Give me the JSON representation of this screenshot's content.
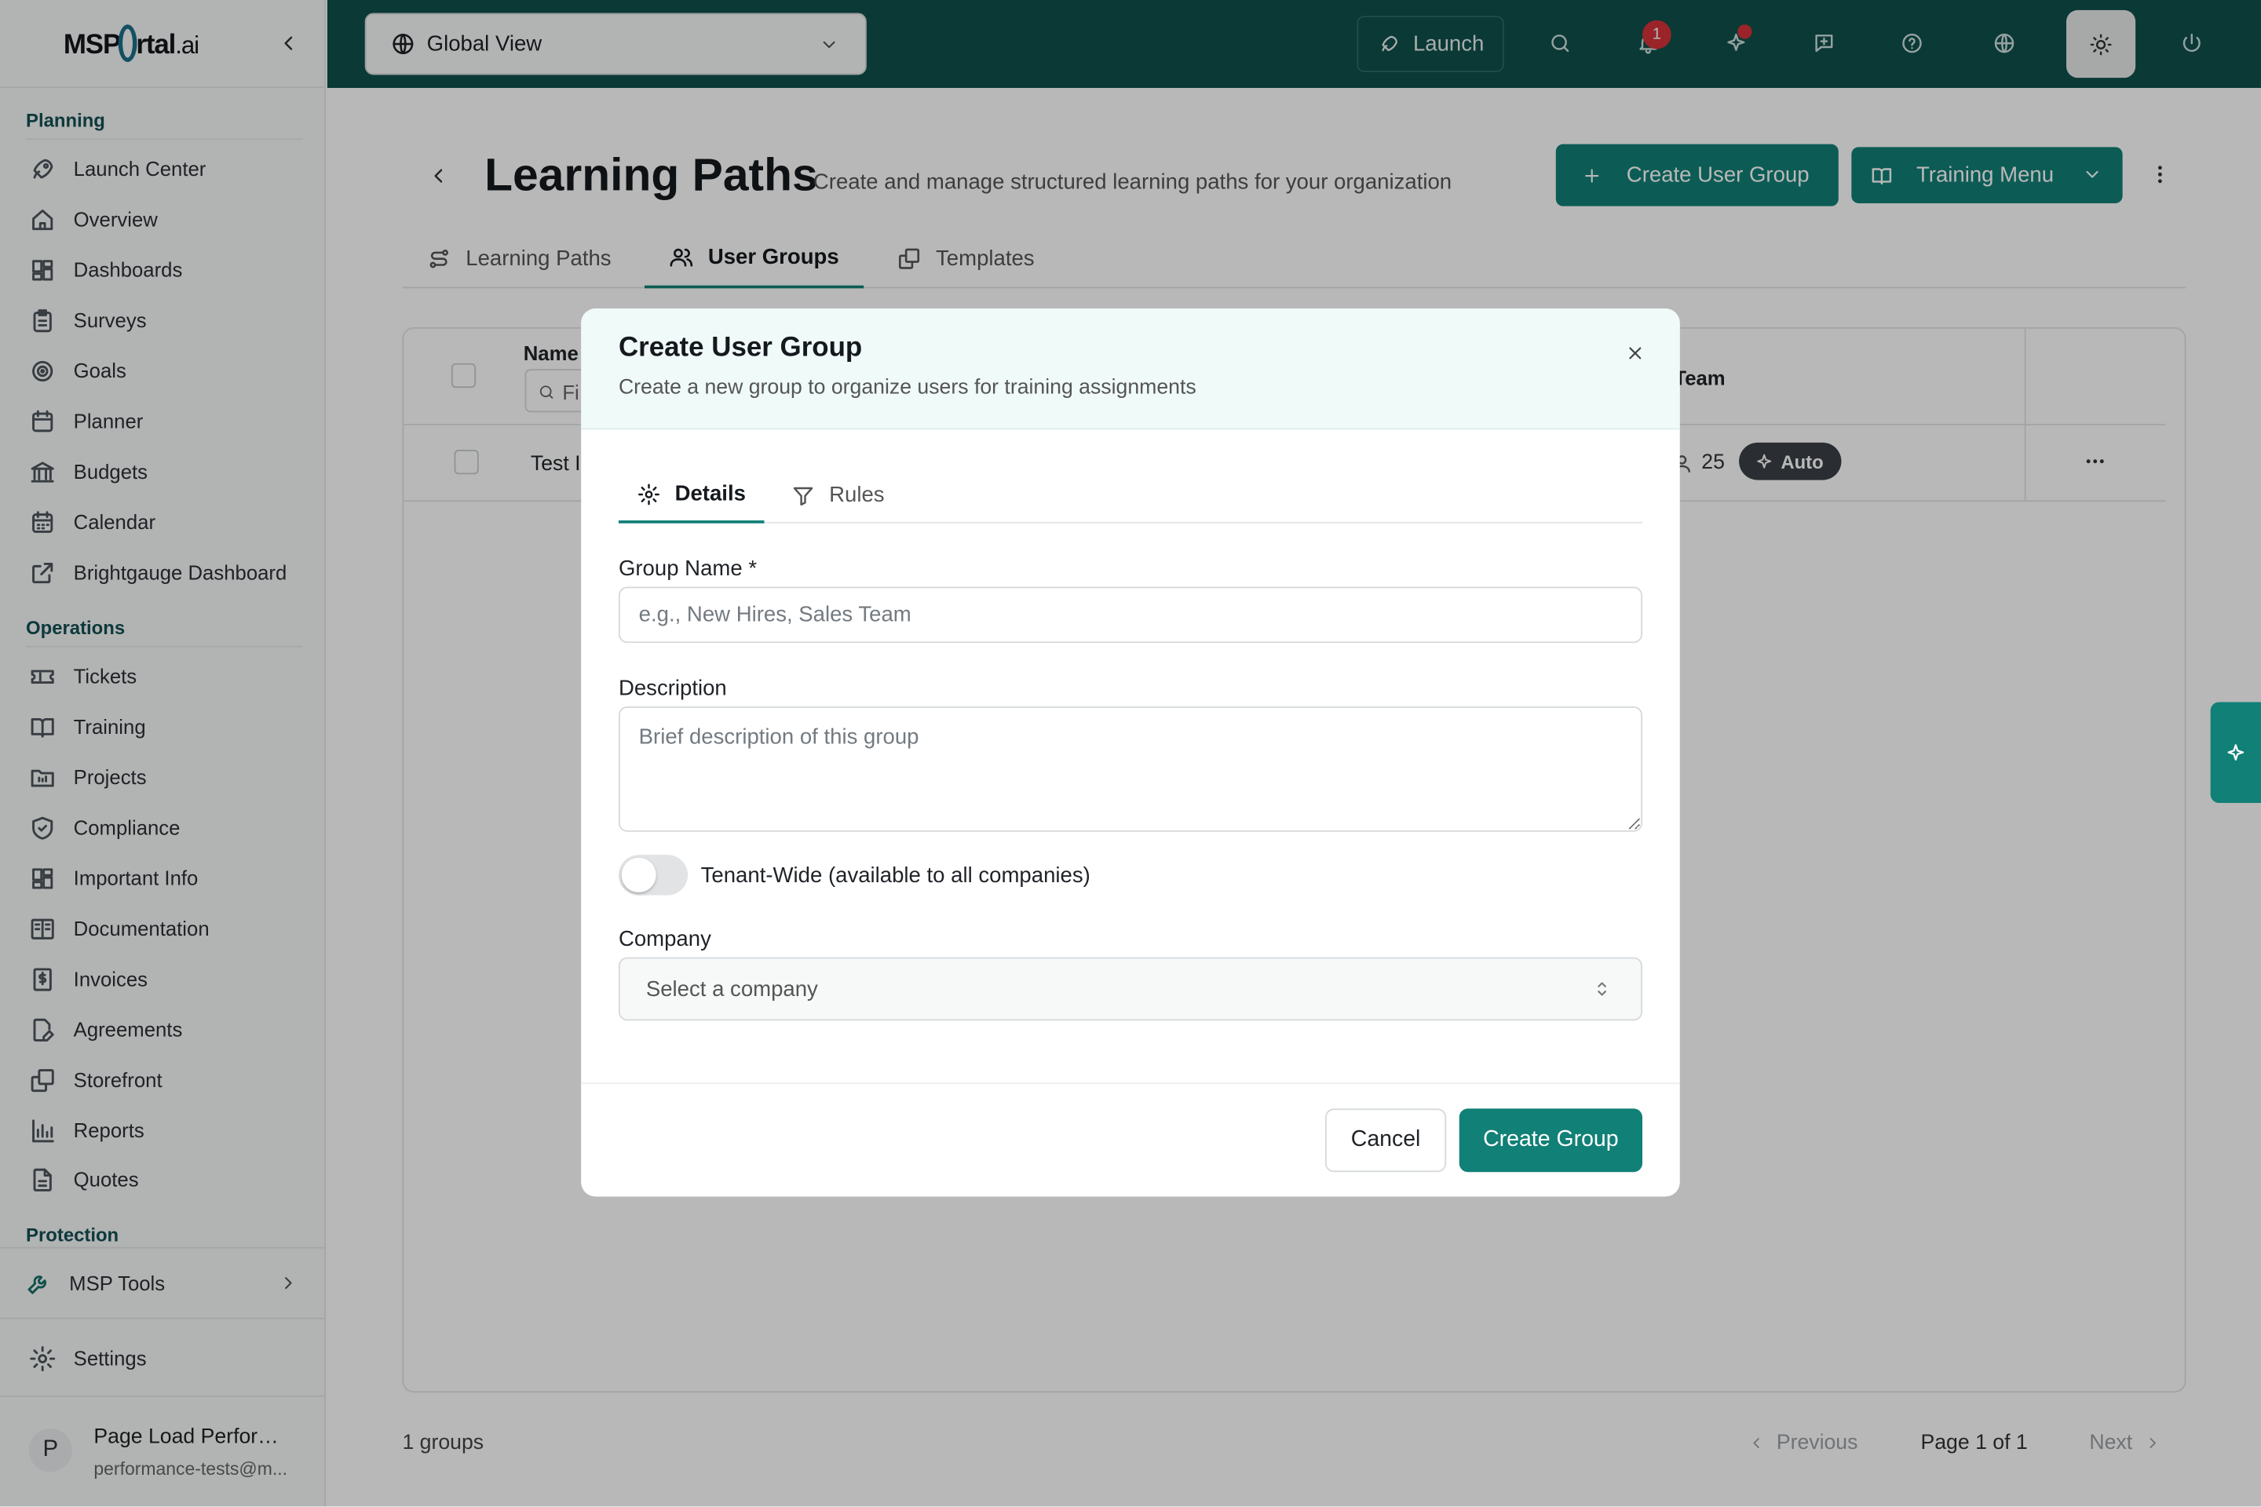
{
  "brand": {
    "logo_prefix": "MSP",
    "logo_mid": "rtal",
    "logo_suffix": ".ai"
  },
  "sidebar": {
    "sections": [
      {
        "title": "Planning",
        "items": [
          "Launch Center",
          "Overview",
          "Dashboards",
          "Surveys",
          "Goals",
          "Planner",
          "Budgets",
          "Calendar",
          "Brightgauge Dashboard"
        ]
      },
      {
        "title": "Operations",
        "items": [
          "Tickets",
          "Training",
          "Projects",
          "Compliance",
          "Important Info",
          "Documentation",
          "Invoices",
          "Agreements",
          "Storefront",
          "Reports",
          "Quotes"
        ]
      },
      {
        "title": "Protection",
        "items": []
      }
    ],
    "msp_tools": "MSP Tools",
    "settings": "Settings",
    "user": {
      "initial": "P",
      "name": "Page Load Performance",
      "email": "performance-tests@m..."
    }
  },
  "topbar": {
    "view_selector": "Global View",
    "launch_label": "Launch",
    "notification_count": "1",
    "icons": [
      "search-icon",
      "bell-icon",
      "sparkle-icon",
      "feedback-icon",
      "help-icon",
      "globe-icon",
      "sun-icon",
      "power-icon"
    ]
  },
  "page": {
    "title": "Learning Paths",
    "subtitle": "Create and manage structured learning paths for your organization",
    "create_button": "Create User Group",
    "training_menu": "Training Menu",
    "tabs": [
      {
        "label": "Learning Paths",
        "active": false
      },
      {
        "label": "User Groups",
        "active": true
      },
      {
        "label": "Templates",
        "active": false
      }
    ],
    "table": {
      "col_name": "Name",
      "filter_placeholder": "Fi",
      "col_team": "Team",
      "rows": [
        {
          "name": "Test I",
          "members": "25",
          "badge": "Auto"
        }
      ]
    },
    "footer": {
      "count": "1 groups",
      "previous": "Previous",
      "page_info": "Page 1 of 1",
      "next": "Next"
    }
  },
  "modal": {
    "title": "Create User Group",
    "subtitle": "Create a new group to organize users for training assignments",
    "tabs": [
      {
        "label": "Details",
        "active": true
      },
      {
        "label": "Rules",
        "active": false
      }
    ],
    "group_name_label": "Group Name *",
    "group_name_placeholder": "e.g., New Hires, Sales Team",
    "group_name_value": "",
    "description_label": "Description",
    "description_placeholder": "Brief description of this group",
    "tenant_wide_label": "Tenant-Wide (available to all companies)",
    "tenant_wide_on": false,
    "company_label": "Company",
    "company_placeholder": "Select a company",
    "cancel": "Cancel",
    "submit": "Create Group"
  },
  "colors": {
    "primary": "#118077",
    "topbar": "#0e4f4b",
    "section_title": "#134f53",
    "badge_red": "#d6333a"
  }
}
